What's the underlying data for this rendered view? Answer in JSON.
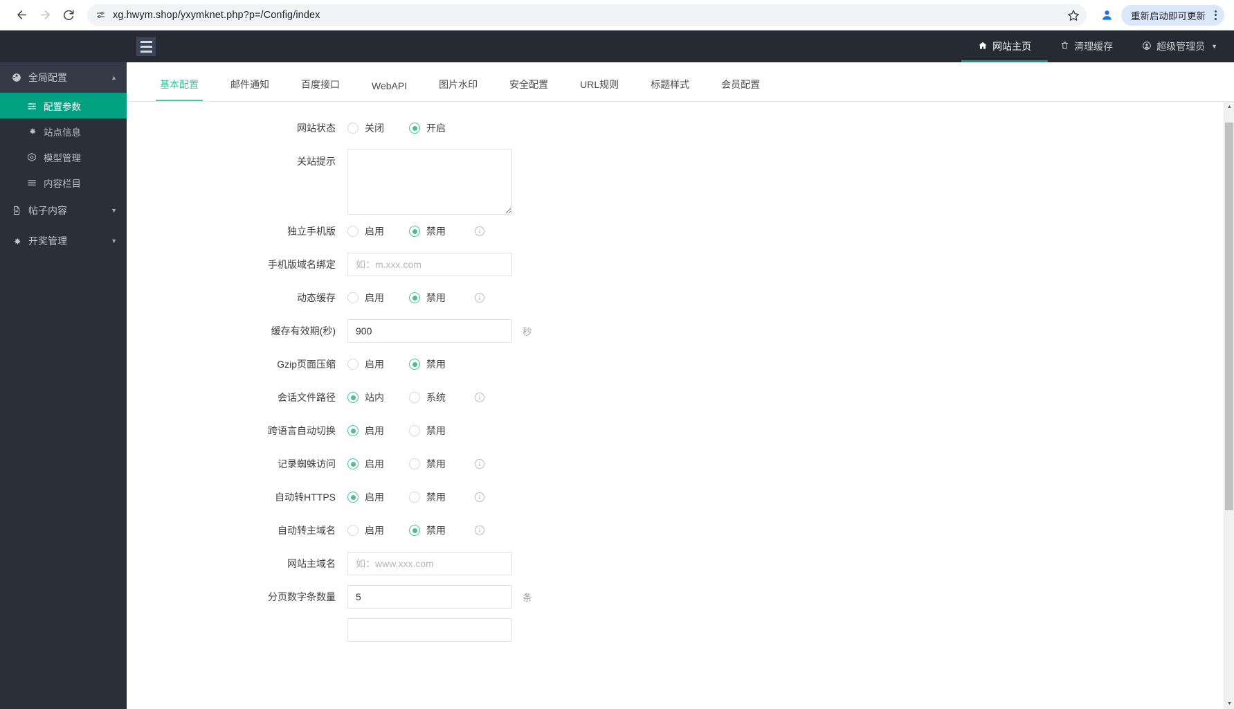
{
  "browser": {
    "url": "xg.hwym.shop/yxymknet.php?p=/Config/index",
    "back_icon": "back-arrow-icon",
    "forward_icon": "forward-arrow-icon",
    "reload_icon": "reload-icon",
    "site_settings_icon": "site-settings-icon",
    "bookmark_icon": "star-icon",
    "profile_icon": "profile-avatar-icon",
    "update_label": "重新启动即可更新",
    "menu_icon": "kebab-menu-icon"
  },
  "sidebar": {
    "groups": [
      {
        "label": "全局配置",
        "icon": "globe-icon",
        "caret": "▲",
        "expanded": true,
        "items": [
          {
            "label": "配置参数",
            "icon": "sliders-icon",
            "active": true
          },
          {
            "label": "站点信息",
            "icon": "gear-icon",
            "active": false
          },
          {
            "label": "模型管理",
            "icon": "cube-icon",
            "active": false
          },
          {
            "label": "内容栏目",
            "icon": "list-icon",
            "active": false
          }
        ]
      },
      {
        "label": "帖子内容",
        "icon": "document-icon",
        "caret": "▼",
        "expanded": false,
        "items": []
      },
      {
        "label": "开奖管理",
        "icon": "gear-icon",
        "caret": "▼",
        "expanded": false,
        "items": []
      }
    ]
  },
  "topbar": {
    "toggle_icon": "hamburger-icon",
    "links": [
      {
        "label": "网站主页",
        "icon": "home-icon",
        "current": true
      },
      {
        "label": "清理缓存",
        "icon": "trash-icon",
        "current": false
      },
      {
        "label": "超级管理员",
        "icon": "user-circle-icon",
        "current": false,
        "caret": "▼"
      }
    ]
  },
  "tabs": [
    {
      "label": "基本配置",
      "active": true
    },
    {
      "label": "邮件通知",
      "active": false
    },
    {
      "label": "百度接口",
      "active": false
    },
    {
      "label": "WebAPI",
      "active": false
    },
    {
      "label": "图片水印",
      "active": false
    },
    {
      "label": "安全配置",
      "active": false
    },
    {
      "label": "URL规则",
      "active": false
    },
    {
      "label": "标题样式",
      "active": false
    },
    {
      "label": "会员配置",
      "active": false
    }
  ],
  "form": {
    "rows": [
      {
        "label": "网站状态",
        "type": "radio",
        "info": false,
        "options": [
          {
            "label": "关闭",
            "checked": false
          },
          {
            "label": "开启",
            "checked": true
          }
        ]
      },
      {
        "label": "关站提示",
        "type": "textarea",
        "value": "",
        "placeholder": ""
      },
      {
        "label": "独立手机版",
        "type": "radio",
        "info": true,
        "options": [
          {
            "label": "启用",
            "checked": false
          },
          {
            "label": "禁用",
            "checked": true
          }
        ]
      },
      {
        "label": "手机版域名绑定",
        "type": "text",
        "value": "",
        "placeholder": "如：m.xxx.com"
      },
      {
        "label": "动态缓存",
        "type": "radio",
        "info": true,
        "options": [
          {
            "label": "启用",
            "checked": false
          },
          {
            "label": "禁用",
            "checked": true
          }
        ]
      },
      {
        "label": "缓存有效期(秒)",
        "type": "text",
        "value": "900",
        "placeholder": "",
        "suffix": "秒"
      },
      {
        "label": "Gzip页面压缩",
        "type": "radio",
        "info": false,
        "options": [
          {
            "label": "启用",
            "checked": false
          },
          {
            "label": "禁用",
            "checked": true
          }
        ]
      },
      {
        "label": "会话文件路径",
        "type": "radio",
        "info": true,
        "options": [
          {
            "label": "站内",
            "checked": true
          },
          {
            "label": "系统",
            "checked": false
          }
        ]
      },
      {
        "label": "跨语言自动切换",
        "type": "radio",
        "info": false,
        "options": [
          {
            "label": "启用",
            "checked": true
          },
          {
            "label": "禁用",
            "checked": false
          }
        ]
      },
      {
        "label": "记录蜘蛛访问",
        "type": "radio",
        "info": true,
        "options": [
          {
            "label": "启用",
            "checked": true
          },
          {
            "label": "禁用",
            "checked": false
          }
        ]
      },
      {
        "label": "自动转HTTPS",
        "type": "radio",
        "info": true,
        "options": [
          {
            "label": "启用",
            "checked": true
          },
          {
            "label": "禁用",
            "checked": false
          }
        ]
      },
      {
        "label": "自动转主域名",
        "type": "radio",
        "info": true,
        "options": [
          {
            "label": "启用",
            "checked": false
          },
          {
            "label": "禁用",
            "checked": true
          }
        ]
      },
      {
        "label": "网站主域名",
        "type": "text",
        "value": "",
        "placeholder": "如：www.xxx.com"
      },
      {
        "label": "分页数字条数量",
        "type": "text",
        "value": "5",
        "placeholder": "",
        "suffix": "条"
      },
      {
        "label": "",
        "type": "text",
        "value": "",
        "placeholder": ""
      }
    ]
  },
  "colors": {
    "accent_green": "#00a181",
    "tab_green": "#3dbf9a",
    "radio_green": "#4bbf93",
    "sidebar_bg": "#2b2f3a",
    "topbar_bg": "#262a33"
  }
}
